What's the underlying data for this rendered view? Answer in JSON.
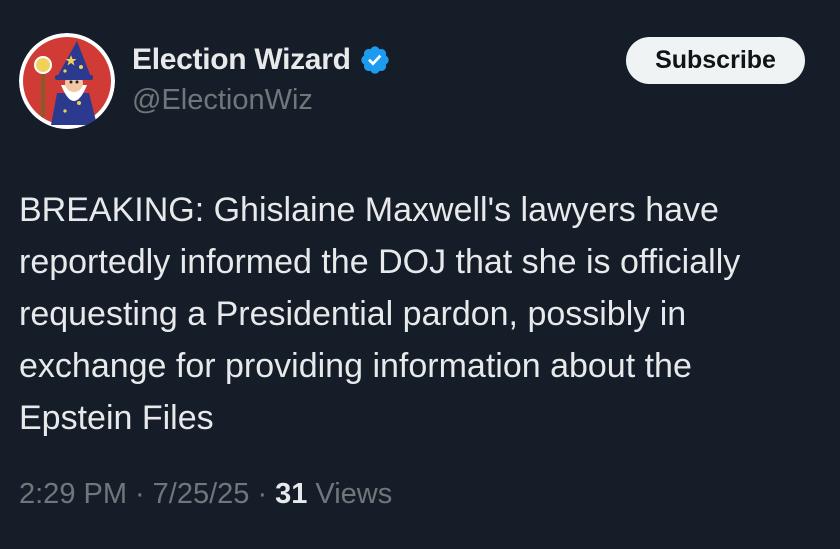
{
  "author": {
    "display_name": "Election Wizard",
    "handle": "@ElectionWiz",
    "verified_icon": "verified-badge-icon",
    "avatar_icon": "wizard-avatar"
  },
  "subscribe_button": {
    "label": "Subscribe"
  },
  "tweet": {
    "text": "BREAKING: Ghislaine Maxwell's lawyers have\nreportedly informed the DOJ that she is officially\nrequesting a Presidential pardon, possibly in\nexchange for providing information about the\nEpstein Files"
  },
  "meta": {
    "time": "2:29 PM",
    "separator": "·",
    "date": "7/25/25",
    "views_count": "31",
    "views_label": "Views"
  },
  "colors": {
    "background": "#151d28",
    "text_primary": "#e7e9ea",
    "text_secondary": "#71767b",
    "verified_blue": "#1d9bf0",
    "button_bg": "#eff3f4",
    "avatar_red": "#d13b36"
  }
}
